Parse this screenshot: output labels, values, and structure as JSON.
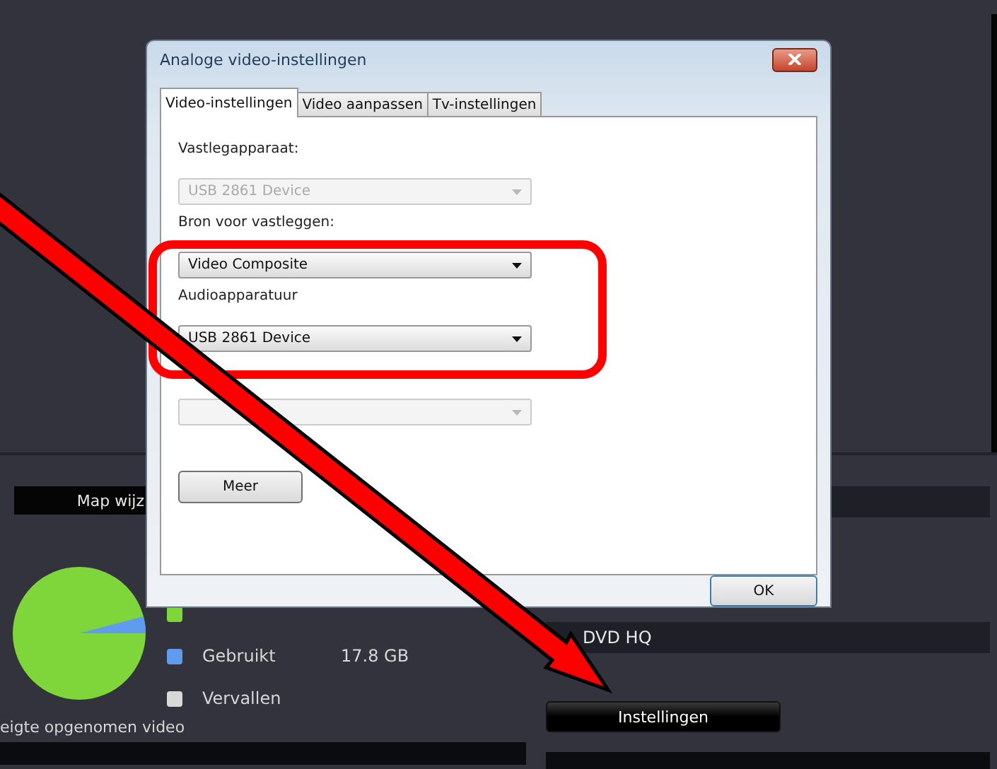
{
  "dialog": {
    "title": "Analoge video-instellingen",
    "tabs": [
      {
        "label": "Video-instellingen",
        "selected": true
      },
      {
        "label": "Video aanpassen",
        "selected": false
      },
      {
        "label": "Tv-instellingen",
        "selected": false
      }
    ],
    "fields": [
      {
        "label": "Vastlegapparaat:",
        "value": "USB 2861 Device",
        "disabled": true
      },
      {
        "label": "Bron voor vastleggen:",
        "value": "Video Composite",
        "disabled": false
      },
      {
        "label": "Audioapparatuur",
        "value": "USB 2861 Device",
        "disabled": false
      },
      {
        "disabled": true
      }
    ],
    "more_button": "Meer",
    "ok_button": "OK"
  },
  "app": {
    "folder_button": "Map wijz",
    "legend": [
      {
        "color": "#7ed63a"
      },
      {
        "label": "Gebruikt",
        "value": "17.8 GB",
        "color": "#5f9cf0"
      },
      {
        "label": "Vervallen",
        "color": "#d8d8d8"
      }
    ],
    "recent_label": "eigte opgenomen video",
    "profile_value": "DVD HQ",
    "settings_button": "Instellingen"
  }
}
